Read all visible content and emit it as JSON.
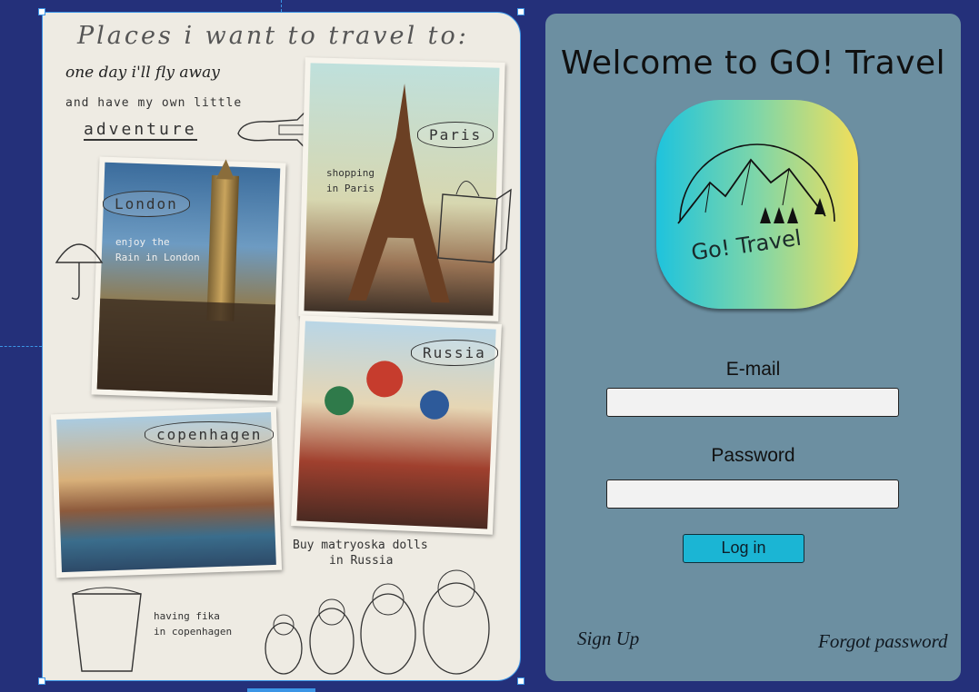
{
  "collage": {
    "title": "Places i want to travel to:",
    "line1": "one day i'll fly away",
    "line2": "and have my own little",
    "line3": "adventure",
    "cities": {
      "london": "London",
      "paris": "Paris",
      "russia": "Russia",
      "copenhagen": "copenhagen"
    },
    "notes": {
      "london": [
        "enjoy the",
        "Rain in London"
      ],
      "paris": [
        "shopping",
        "in Paris"
      ],
      "russia": [
        "Buy matryoska dolls",
        "in Russia"
      ],
      "copenhagen": [
        "having fika",
        "in copenhagen"
      ]
    }
  },
  "login": {
    "welcome": "Welcome to GO! Travel",
    "logo_text": "Go! Travel",
    "email_label": "E-mail",
    "password_label": "Password",
    "email_value": "",
    "password_value": "",
    "login_button": "Log in",
    "signup_link": "Sign Up",
    "forgot_link": "Forgot password"
  },
  "colors": {
    "background": "#24307a",
    "panel": "#6c8fa1",
    "accent": "#1bb5d4",
    "selection": "#3b95e6"
  }
}
